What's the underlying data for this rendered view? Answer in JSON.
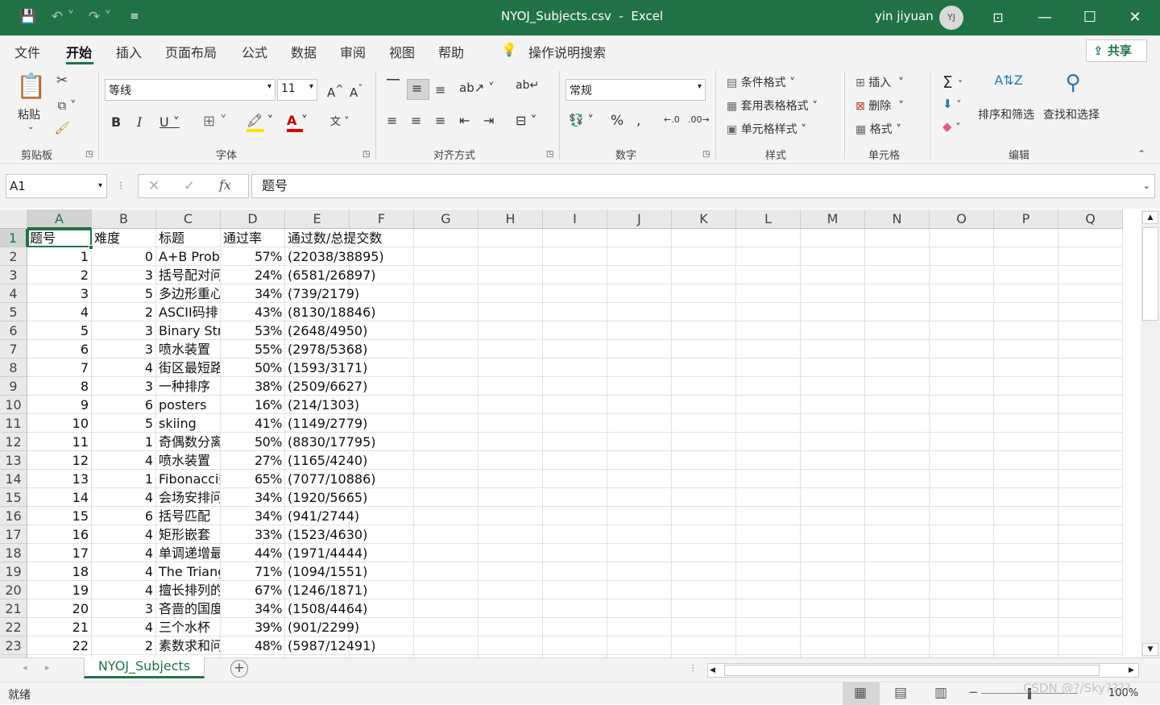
{
  "title": {
    "file": "NYOJ_Subjects.csv",
    "sep": "-",
    "app": "Excel",
    "user": "yin jiyuan",
    "initials": "YJ"
  },
  "tabs": [
    "文件",
    "开始",
    "插入",
    "页面布局",
    "公式",
    "数据",
    "审阅",
    "视图",
    "帮助"
  ],
  "tell_me": "操作说明搜索",
  "share": "共享",
  "ribbon": {
    "clipboard": {
      "label": "剪贴板",
      "paste": "粘贴"
    },
    "font": {
      "label": "字体",
      "name": "等线",
      "size": "11"
    },
    "alignment": {
      "label": "对齐方式"
    },
    "number": {
      "label": "数字",
      "format": "常规"
    },
    "styles": {
      "label": "样式",
      "cond": "条件格式",
      "table": "套用表格格式",
      "cell": "单元格样式"
    },
    "cells": {
      "label": "单元格",
      "insert": "插入",
      "delete": "删除",
      "format": "格式"
    },
    "editing": {
      "label": "编辑",
      "sort": "排序和筛选",
      "find": "查找和选择"
    }
  },
  "namebox": "A1",
  "formula": "题号",
  "columns": [
    "A",
    "B",
    "C",
    "D",
    "E",
    "F",
    "G",
    "H",
    "I",
    "J",
    "K",
    "L",
    "M",
    "N",
    "O",
    "P",
    "Q"
  ],
  "header_row": [
    "题号",
    "难度",
    "标题",
    "通过率",
    "通过数/总提交数"
  ],
  "rows": [
    [
      "1",
      "0",
      "A+B Probl",
      "57%",
      "(22038/38895)"
    ],
    [
      "2",
      "3",
      "括号配对问",
      "24%",
      "(6581/26897)"
    ],
    [
      "3",
      "5",
      "多边形重心",
      "34%",
      "(739/2179)"
    ],
    [
      "4",
      "2",
      "ASCII码排",
      "43%",
      "(8130/18846)"
    ],
    [
      "5",
      "3",
      "Binary Stri",
      "53%",
      "(2648/4950)"
    ],
    [
      "6",
      "3",
      "喷水装置",
      "55%",
      "(2978/5368)"
    ],
    [
      "7",
      "4",
      "街区最短路",
      "50%",
      "(1593/3171)"
    ],
    [
      "8",
      "3",
      "一种排序",
      "38%",
      "(2509/6627)"
    ],
    [
      "9",
      "6",
      "posters",
      "16%",
      "(214/1303)"
    ],
    [
      "10",
      "5",
      "skiing",
      "41%",
      "(1149/2779)"
    ],
    [
      "11",
      "1",
      "奇偶数分离",
      "50%",
      "(8830/17795)"
    ],
    [
      "12",
      "4",
      "喷水装置",
      "27%",
      "(1165/4240)"
    ],
    [
      "13",
      "1",
      "Fibonacci数",
      "65%",
      "(7077/10886)"
    ],
    [
      "14",
      "4",
      "会场安排问",
      "34%",
      "(1920/5665)"
    ],
    [
      "15",
      "6",
      "括号匹配",
      "34%",
      "(941/2744)"
    ],
    [
      "16",
      "4",
      "矩形嵌套",
      "33%",
      "(1523/4630)"
    ],
    [
      "17",
      "4",
      "单调递增最",
      "44%",
      "(1971/4444)"
    ],
    [
      "18",
      "4",
      "The Triang",
      "71%",
      "(1094/1551)"
    ],
    [
      "19",
      "4",
      "擅长排列的",
      "67%",
      "(1246/1871)"
    ],
    [
      "20",
      "3",
      "吝啬的国度",
      "34%",
      "(1508/4464)"
    ],
    [
      "21",
      "4",
      "三个水杯",
      "39%",
      "(901/2299)"
    ],
    [
      "22",
      "2",
      "素数求和问",
      "48%",
      "(5987/12491)"
    ]
  ],
  "sheet_tab": "NYOJ_Subjects",
  "status": "就绪",
  "zoom": "100%",
  "watermark": "CSDN @?/Sky????",
  "colors": {
    "accent": "#217346"
  }
}
